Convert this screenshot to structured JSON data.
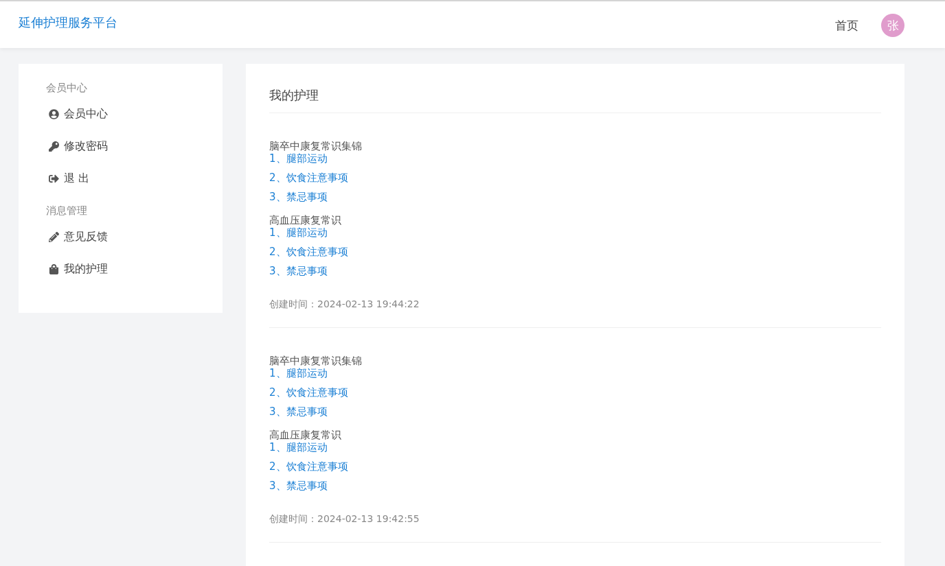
{
  "header": {
    "brand": "延伸护理服务平台",
    "nav": [
      "首页"
    ],
    "avatar": "张"
  },
  "sidebar": {
    "sections": [
      {
        "title": "会员中心",
        "items": [
          {
            "label": "会员中心",
            "kind": "user"
          },
          {
            "label": "修改密码",
            "kind": "key"
          },
          {
            "label": "退 出",
            "kind": "logout"
          }
        ]
      },
      {
        "title": "消息管理",
        "items": [
          {
            "label": "意见反馈",
            "kind": "pencil"
          },
          {
            "label": "我的护理",
            "kind": "bag"
          }
        ]
      }
    ]
  },
  "main": {
    "title": "我的护理",
    "records": [
      {
        "groups": [
          {
            "title": "脑卒中康复常识集锦",
            "links": [
              "1、腿部运动",
              "2、饮食注意事项",
              "3、禁忌事项"
            ]
          },
          {
            "title": "高血压康复常识",
            "links": [
              "1、腿部运动",
              "2、饮食注意事项",
              "3、禁忌事项"
            ]
          }
        ],
        "created": "创建时间：2024-02-13 19:44:22"
      },
      {
        "groups": [
          {
            "title": "脑卒中康复常识集锦",
            "links": [
              "1、腿部运动",
              "2、饮食注意事项",
              "3、禁忌事项"
            ]
          },
          {
            "title": "高血压康复常识",
            "links": [
              "1、腿部运动",
              "2、饮食注意事项",
              "3、禁忌事项"
            ]
          }
        ],
        "created": "创建时间：2024-02-13 19:42:55"
      }
    ]
  }
}
